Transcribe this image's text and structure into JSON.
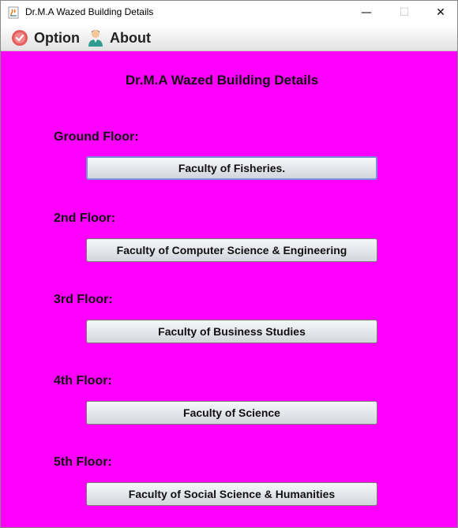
{
  "window": {
    "title": "Dr.M.A Wazed Building Details",
    "minimize": "—",
    "maximize": "☐",
    "close": "✕"
  },
  "menu": {
    "option_label": "Option",
    "about_label": "About"
  },
  "main": {
    "heading": "Dr.M.A Wazed Building Details",
    "floors": [
      {
        "label": "Ground Floor:",
        "button": "Faculty of Fisheries."
      },
      {
        "label": "2nd Floor:",
        "button": "Faculty of Computer Science & Engineering"
      },
      {
        "label": "3rd Floor:",
        "button": "Faculty of Business Studies"
      },
      {
        "label": "4th Floor:",
        "button": "Faculty of Science"
      },
      {
        "label": "5th Floor:",
        "button": "Faculty of Social Science & Humanities"
      }
    ]
  },
  "colors": {
    "background": "#ff00ff",
    "focus_border": "#7b8fd8"
  }
}
